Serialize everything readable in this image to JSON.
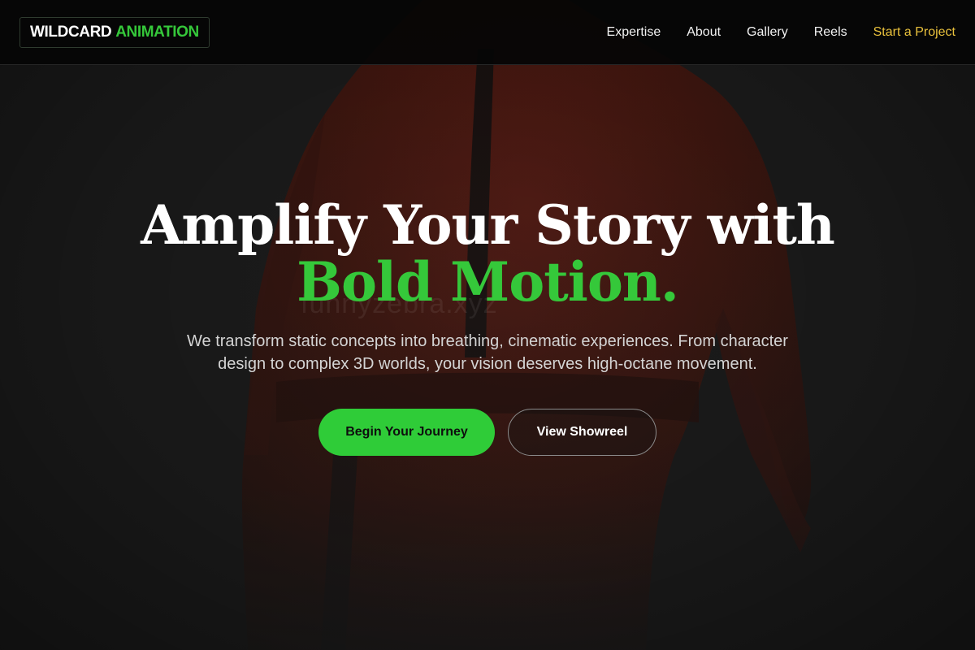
{
  "brand": {
    "name_part1": "WILDCARD",
    "name_part2": "ANIMATION"
  },
  "nav": {
    "items": [
      {
        "label": "Expertise"
      },
      {
        "label": "About"
      },
      {
        "label": "Gallery"
      },
      {
        "label": "Reels"
      }
    ],
    "cta_label": "Start a Project"
  },
  "hero": {
    "title_line1": "Amplify Your Story with",
    "title_line2": "Bold Motion.",
    "subtitle": "We transform static concepts into breathing, cinematic experiences. From character design to complex 3D worlds, your vision deserves high-octane movement.",
    "primary_button": "Begin Your Journey",
    "secondary_button": "View Showreel"
  },
  "watermark": "funnyzebra.xyz",
  "colors": {
    "accent_green": "#35c83a",
    "button_green": "#2fcc38",
    "cta_gold": "#e9c13c",
    "background": "#1c1c1c"
  }
}
